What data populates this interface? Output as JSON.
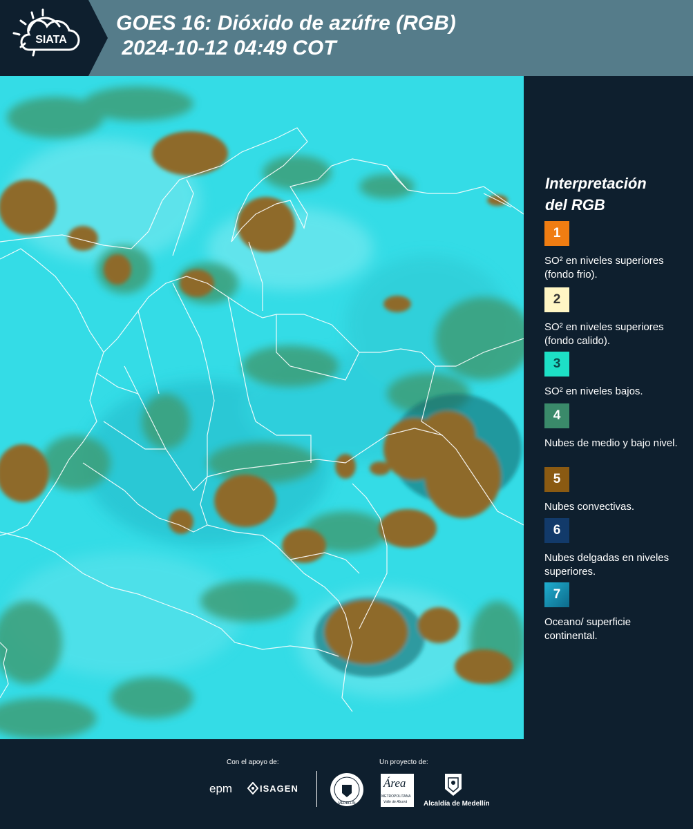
{
  "header": {
    "logo_text": "SIATA",
    "title_line1": "GOES 16: Dióxido de azúfre (RGB)",
    "title_line2": " 2024-10-12 04:49 COT"
  },
  "legend": {
    "title_line1": "Interpretación",
    "title_line2": "del RGB",
    "items": [
      {
        "number": "1",
        "color": "#f07d12",
        "text": "SO² en niveles superiores (fondo frio)."
      },
      {
        "number": "2",
        "color": "#fff6c4",
        "text": "SO² en niveles superiores (fondo calido)."
      },
      {
        "number": "3",
        "color": "#1de0c6",
        "text": "SO² en niveles bajos."
      },
      {
        "number": "4",
        "color": "#3a8a6a",
        "text": "Nubes de medio y bajo nivel."
      },
      {
        "number": "5",
        "color": "#8a5a12",
        "text": "Nubes convectivas."
      },
      {
        "number": "6",
        "color": "#123a6a",
        "text": "Nubes delgadas en niveles superiores."
      },
      {
        "number": "7",
        "color": "#1a8fb0",
        "text": "Oceano/ superficie continental."
      }
    ]
  },
  "footer": {
    "support_label": "Con el apoyo de:",
    "project_label": "Un proyecto de:",
    "epm_text": "epm",
    "isagen_text": "ISAGEN",
    "area_text": "Área",
    "metropolitana_text": "METROPOLITANA",
    "valle_text": "Valle de Aburrá",
    "medellin_seal_text": "MEDELLÍN",
    "alcaldia_text": "Alcaldía de Medellín"
  },
  "colors": {
    "background": "#0e1f2e",
    "header": "#557c8a",
    "map_background": "#2fd8e3",
    "clouds_convective": "#8e6a2c",
    "clouds_low": "#3e9e78"
  }
}
